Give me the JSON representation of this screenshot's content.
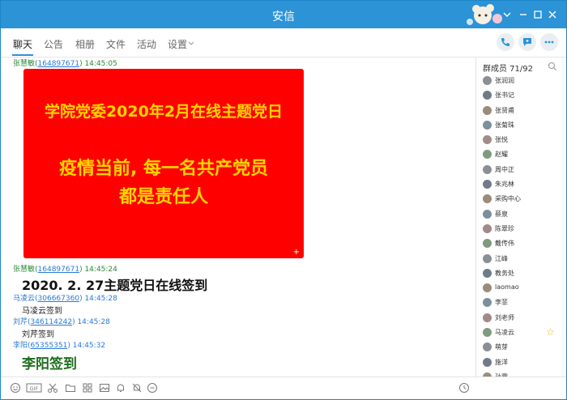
{
  "window": {
    "title": "安信"
  },
  "tabs": [
    {
      "label": "聊天"
    },
    {
      "label": "公告"
    },
    {
      "label": "相册"
    },
    {
      "label": "文件"
    },
    {
      "label": "活动"
    },
    {
      "label": "设置"
    }
  ],
  "chat": {
    "messages": [
      {
        "sender": "张慧敏",
        "uid": "164897671",
        "time": "14:45:05"
      },
      {
        "sender": "张慧敏",
        "uid": "164897671",
        "time": "14:45:24",
        "text": "2020. 2. 27主题党日在线签到"
      },
      {
        "sender": "马凌云",
        "uid": "306667360",
        "time": "14:45:28",
        "text": "马凌云签到"
      },
      {
        "sender": "刘芹",
        "uid": "346114242",
        "time": "14:45:28",
        "text": "刘芹签到"
      },
      {
        "sender": "李阳",
        "uid": "65355351",
        "time": "14:45:32",
        "text": "李阳签到"
      }
    ],
    "poster": {
      "line1": "学院党委2020年2月在线主题党日",
      "line2": "疫情当前, 每一名共产党员",
      "line3": "都是责任人",
      "expand": "+"
    }
  },
  "members": {
    "title": "群成员 71/92",
    "list": [
      {
        "name": "张润润"
      },
      {
        "name": "张书记"
      },
      {
        "name": "张贤甫"
      },
      {
        "name": "张菊珠"
      },
      {
        "name": "张悦"
      },
      {
        "name": "赵耀"
      },
      {
        "name": "周中正"
      },
      {
        "name": "朱兆林"
      },
      {
        "name": "采购中心"
      },
      {
        "name": "蔡泉"
      },
      {
        "name": "陈翠珍"
      },
      {
        "name": "戴传伟"
      },
      {
        "name": "江峰"
      },
      {
        "name": "教务处"
      },
      {
        "name": "laomao"
      },
      {
        "name": "李菲"
      },
      {
        "name": "刘老师"
      },
      {
        "name": "马凌云",
        "starred": true
      },
      {
        "name": "萌芽"
      },
      {
        "name": "施洋"
      },
      {
        "name": "孙霞"
      }
    ]
  },
  "colors": {
    "accent": "#2b93d6",
    "poster_bg": "#ff0000",
    "poster_text": "#ffd400"
  }
}
